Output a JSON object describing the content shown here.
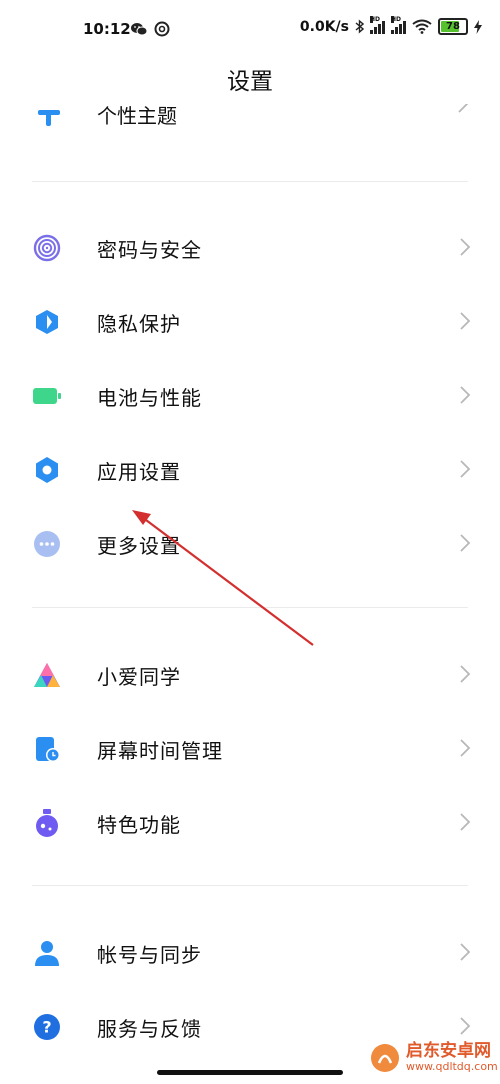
{
  "status_bar": {
    "time": "10:12",
    "speed": "0.0K/s",
    "battery": "78",
    "battery_level": 0.78,
    "left_icons": [
      "wechat-icon",
      "circle-a-icon"
    ],
    "right_icons": [
      "bluetooth-icon",
      "signal-hd-icon",
      "signal-hd-icon",
      "wifi-icon",
      "battery-icon",
      "charging-icon"
    ]
  },
  "header": {
    "title": "设置"
  },
  "partial_item": {
    "label": "个性主题",
    "icon": "theme-icon"
  },
  "groups": [
    {
      "items": [
        {
          "label": "密码与安全",
          "icon": "fingerprint-icon",
          "color": "#7b6fe8"
        },
        {
          "label": "隐私保护",
          "icon": "privacy-shield-icon",
          "color": "#2a8ff0"
        },
        {
          "label": "电池与性能",
          "icon": "battery-icon",
          "color": "#3ed68a"
        },
        {
          "label": "应用设置",
          "icon": "gear-icon",
          "color": "#2a8ff0"
        },
        {
          "label": "更多设置",
          "icon": "more-dots-icon",
          "color": "#9db6ef"
        }
      ]
    },
    {
      "items": [
        {
          "label": "小爱同学",
          "icon": "xiaoai-icon",
          "color": "#6a5af0"
        },
        {
          "label": "屏幕时间管理",
          "icon": "screen-time-icon",
          "color": "#2a8ff0"
        },
        {
          "label": "特色功能",
          "icon": "flask-icon",
          "color": "#6f5bf2"
        }
      ]
    },
    {
      "items": [
        {
          "label": "帐号与同步",
          "icon": "account-icon",
          "color": "#2a8ff0"
        },
        {
          "label": "服务与反馈",
          "icon": "help-icon",
          "color": "#1f6fe0"
        }
      ]
    }
  ],
  "watermark": {
    "name": "启东安卓网",
    "url": "www.qdltdq.com"
  },
  "colors": {
    "accent": "#2a8ff0",
    "annotation_arrow": "#d32f2f"
  }
}
